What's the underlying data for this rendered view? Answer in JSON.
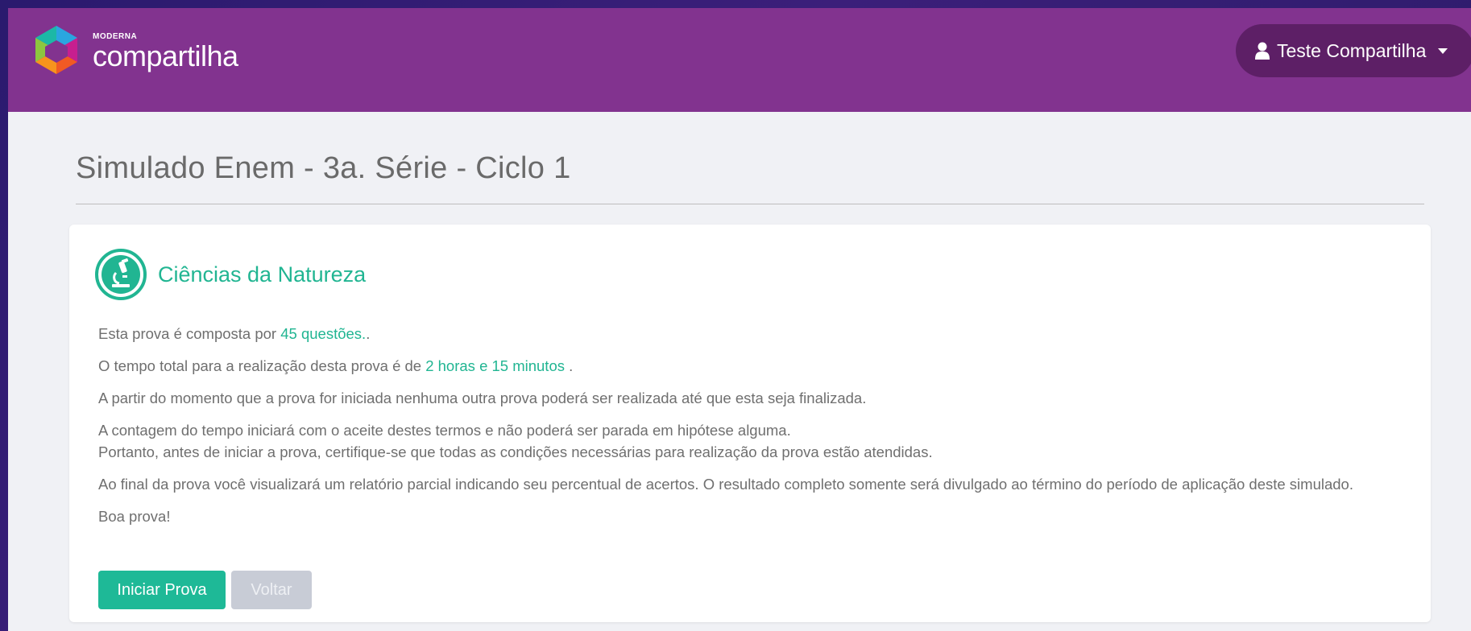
{
  "header": {
    "brand_small": "MODERNA",
    "brand_name": "compartilha",
    "user_name": "Teste Compartilha"
  },
  "page": {
    "title": "Simulado Enem - 3a. Série - Ciclo 1"
  },
  "card": {
    "subject": "Ciências da Natureza",
    "p1_prefix": "Esta prova é composta por ",
    "p1_highlight": "45 questões.",
    "p1_suffix": ".",
    "p2_prefix": "O tempo total para a realização desta prova é de ",
    "p2_highlight": "2 horas e 15 minutos",
    "p2_suffix": " .",
    "p3": "A partir do momento que a prova for iniciada nenhuma outra prova poderá ser realizada até que esta seja finalizada.",
    "p4_line1": "A contagem do tempo iniciará com o aceite destes termos e não poderá ser parada em hipótese alguma.",
    "p4_line2": "Portanto, antes de iniciar a prova, certifique-se que todas as condições necessárias para realização da prova estão atendidas.",
    "p5": "Ao final da prova você visualizará um relatório parcial indicando seu percentual de acertos. O resultado completo somente será divulgado ao término do período de aplicação deste simulado.",
    "p6": "Boa prova!",
    "start_label": "Iniciar Prova",
    "back_label": "Voltar"
  },
  "colors": {
    "header_bg": "#82338f",
    "accent": "#21b592",
    "start_button": "#1eb997",
    "back_button": "#c8ccd6"
  },
  "icons": {
    "logo": "moderna-logo-icon",
    "user": "user-icon",
    "dropdown": "caret-down-icon",
    "subject": "microscope-icon"
  }
}
